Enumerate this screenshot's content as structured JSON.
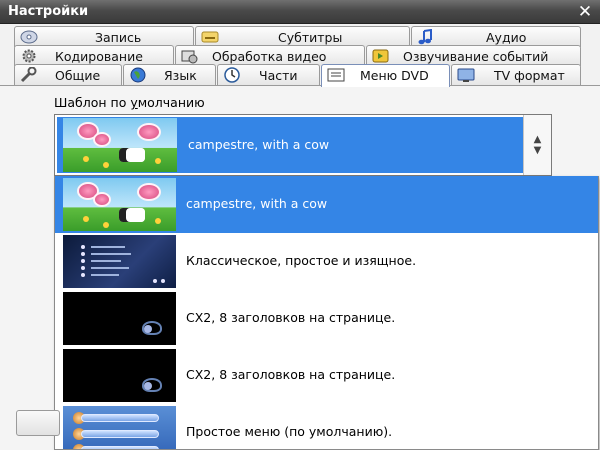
{
  "window": {
    "title": "Настройки",
    "close_glyph": "✕"
  },
  "tabs_row1": [
    {
      "label": "Запись",
      "icon": "disc-icon"
    },
    {
      "label": "Субтитры",
      "icon": "subtitles-icon"
    },
    {
      "label": "Аудио",
      "icon": "music-note-icon"
    }
  ],
  "tabs_row2": [
    {
      "label": "Кодирование",
      "icon": "gear-icon"
    },
    {
      "label": "Обработка видео",
      "icon": "video-processing-icon"
    },
    {
      "label": "Озвучивание событий",
      "icon": "event-sound-icon"
    }
  ],
  "tabs_row3": [
    {
      "label": "Общие",
      "icon": "tools-icon"
    },
    {
      "label": "Язык",
      "icon": "globe-icon"
    },
    {
      "label": "Части",
      "icon": "clock-icon"
    },
    {
      "label": "Меню DVD",
      "icon": "dvd-menu-icon",
      "active": true
    },
    {
      "label": "TV формат",
      "icon": "tv-icon"
    }
  ],
  "template": {
    "label_prefix": "Шаблон по ",
    "label_underlined": "у",
    "label_suffix": "молчанию",
    "selected": "campestre, with a cow",
    "options": [
      {
        "label": "campestre, with a cow",
        "thumb": "campestre"
      },
      {
        "label": "Классическое, простое и изящное.",
        "thumb": "classic"
      },
      {
        "label": "CX2, 8 заголовков на странице.",
        "thumb": "black"
      },
      {
        "label": "CX2, 8 заголовков на странице.",
        "thumb": "black"
      },
      {
        "label": "Простое меню (по умолчанию).",
        "thumb": "simple"
      }
    ]
  },
  "colors": {
    "selection": "#3485e6",
    "titlebar": "#4a4a4a"
  }
}
